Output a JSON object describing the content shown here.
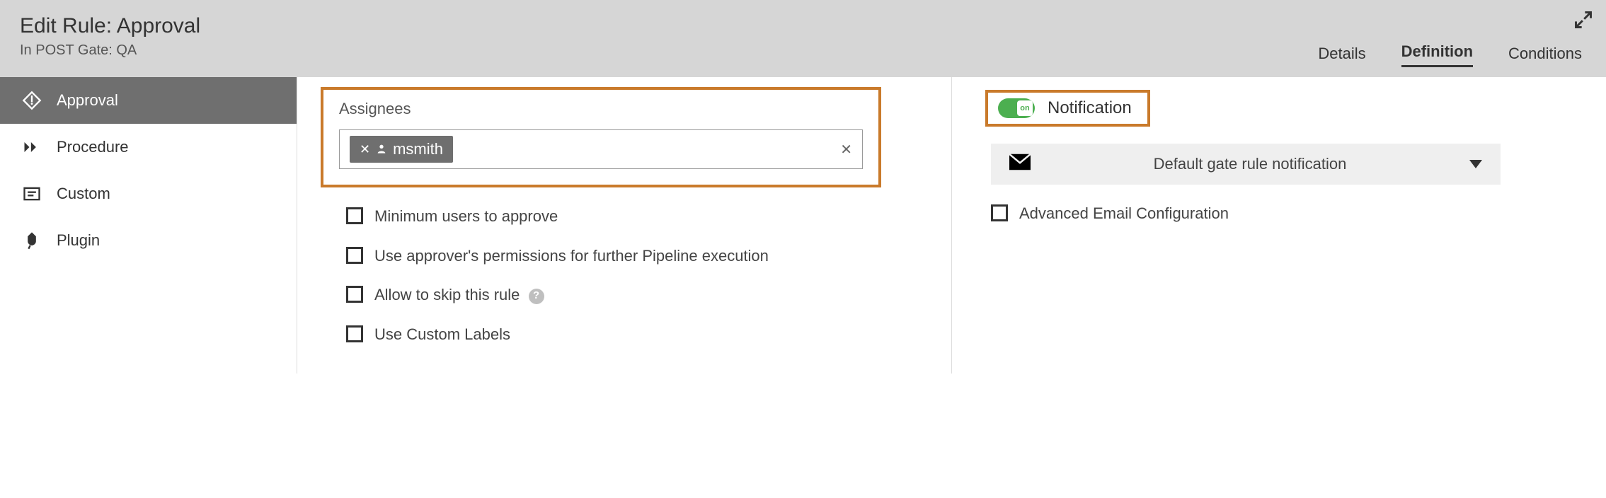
{
  "header": {
    "title": "Edit Rule: Approval",
    "subtitle": "In POST Gate: QA",
    "tabs": {
      "details": "Details",
      "definition": "Definition",
      "conditions": "Conditions"
    },
    "active_tab": "definition"
  },
  "sidebar": {
    "items": [
      {
        "label": "Approval",
        "icon": "approval-icon",
        "active": true
      },
      {
        "label": "Procedure",
        "icon": "procedure-icon",
        "active": false
      },
      {
        "label": "Custom",
        "icon": "custom-icon",
        "active": false
      },
      {
        "label": "Plugin",
        "icon": "plugin-icon",
        "active": false
      }
    ]
  },
  "assignees": {
    "label": "Assignees",
    "chips": [
      {
        "name": "msmith"
      }
    ]
  },
  "options": {
    "min_users": {
      "label": "Minimum users to approve",
      "checked": false
    },
    "approver_perms": {
      "label": "Use approver's permissions for further Pipeline execution",
      "checked": false
    },
    "allow_skip": {
      "label": "Allow to skip this rule",
      "checked": false,
      "help": true
    },
    "custom_labels": {
      "label": "Use Custom Labels",
      "checked": false
    }
  },
  "notification": {
    "label": "Notification",
    "toggle_on": true,
    "toggle_text": "on",
    "selected": "Default gate rule notification",
    "advanced": {
      "label": "Advanced Email Configuration",
      "checked": false
    }
  },
  "colors": {
    "highlight": "#c97a2b",
    "active_bg": "#6f6f6f",
    "toggle_on": "#4caf50"
  }
}
